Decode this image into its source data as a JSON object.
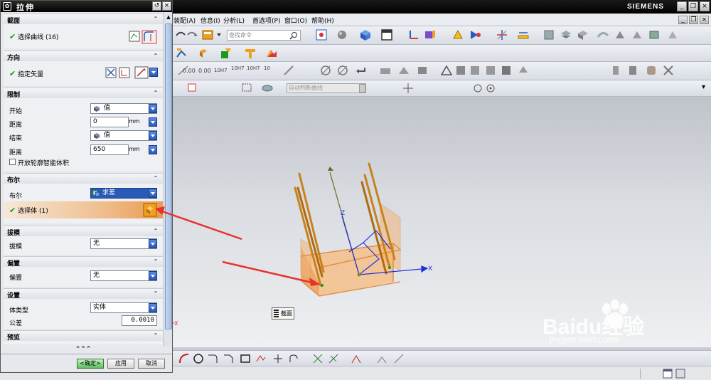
{
  "app": {
    "brand": "SIEMENS",
    "menu": [
      "装配(A)",
      "信息(I)",
      "分析(L)",
      "首选项(P)",
      "窗口(O)",
      "帮助(H)"
    ],
    "search_placeholder": "查找命令",
    "filter_value": "自动判断曲线"
  },
  "toolbar2_labels": [
    "0.00",
    "0.00",
    "10H7",
    "10H7",
    "10H7",
    "10"
  ],
  "dialog": {
    "title": "拉伸",
    "sections": {
      "section": {
        "title": "截面",
        "row_label": "选择曲线 (16)"
      },
      "direction": {
        "title": "方向",
        "row_label": "指定矢量"
      },
      "limits": {
        "title": "限制",
        "start_label": "开始",
        "start_value": "值",
        "start_distance_label": "距离",
        "start_distance_value": "0",
        "end_label": "结束",
        "end_value": "值",
        "end_distance_label": "距离",
        "end_distance_value": "650",
        "unit": "mm",
        "open_profile_label": "开放轮廓智能体积"
      },
      "boolean": {
        "title": "布尔",
        "boolean_label": "布尔",
        "boolean_value": "求差",
        "select_body_label": "选择体 (1)"
      },
      "draft": {
        "title": "拔模",
        "label": "拔模",
        "value": "无"
      },
      "offset": {
        "title": "偏置",
        "label": "偏置",
        "value": "无"
      },
      "settings": {
        "title": "设置",
        "body_type_label": "体类型",
        "body_type_value": "实体",
        "tolerance_label": "公差",
        "tolerance_value": "0.0010"
      },
      "preview": {
        "title": "预览"
      }
    },
    "ok_label": "<确定>",
    "apply_label": "应用",
    "cancel_label": "取消"
  },
  "viewport": {
    "tooltip": "截面",
    "axis_x": "X",
    "axis_z": "Z",
    "axis_x_left": "X"
  },
  "watermark": {
    "brand": "Baidu经验",
    "url": "jingyan.baidu.com"
  },
  "colors": {
    "arrow": "#e8322c",
    "body_fill": "#f5c08a",
    "rods": "#c8821c",
    "axis": "#2030e0"
  }
}
